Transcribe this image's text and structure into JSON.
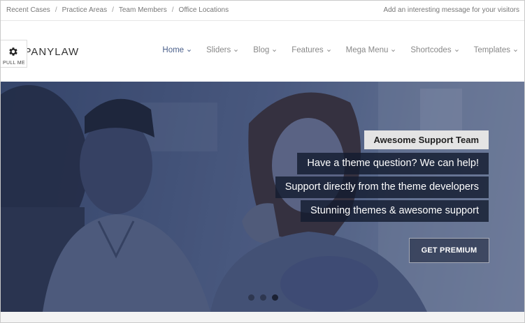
{
  "topbar": {
    "links": [
      "Recent Cases",
      "Practice Areas",
      "Team Members",
      "Office Locations"
    ],
    "separator": "/",
    "message": "Add an interesting message for your visitors"
  },
  "header": {
    "logo_text": "MPANYLAW",
    "pull_me_label": "PULL ME"
  },
  "nav": {
    "items": [
      "Home",
      "Sliders",
      "Blog",
      "Features",
      "Mega Menu",
      "Shortcodes",
      "Templates"
    ],
    "active": "Home"
  },
  "hero": {
    "captions": [
      "Awesome Support Team",
      "Have a theme question? We can help!",
      "Support directly from the theme developers",
      "Stunning themes & awesome support"
    ],
    "button_label": "GET PREMIUM",
    "slide_count": 3,
    "active_slide": 3
  },
  "colors": {
    "nav_active": "#4a5f8a",
    "caption_bg": "#141c30",
    "caption_highlight_bg": "#e4e4e4"
  }
}
